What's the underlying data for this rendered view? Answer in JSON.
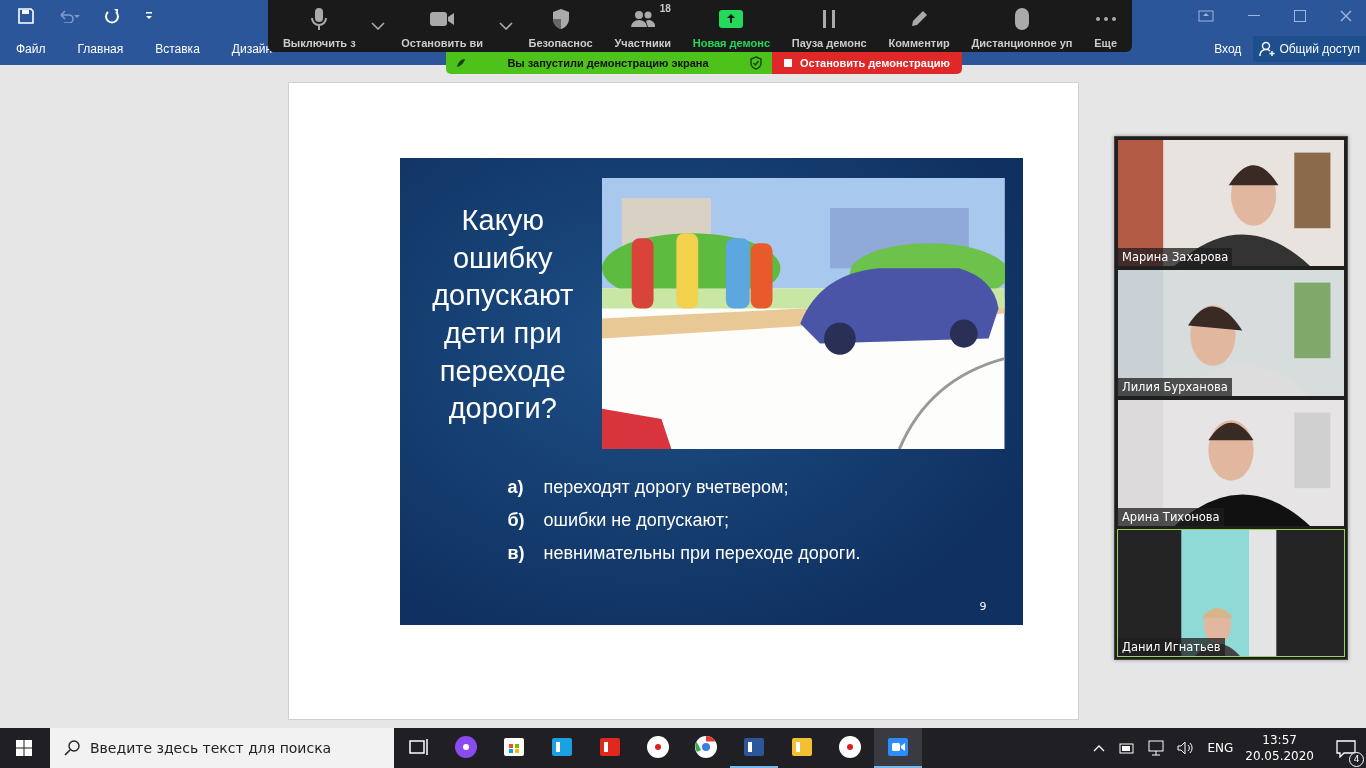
{
  "quick_access": [
    {
      "kind": "save",
      "disabled": false
    },
    {
      "kind": "undo",
      "disabled": true
    },
    {
      "kind": "redo",
      "disabled": false
    },
    {
      "kind": "customize",
      "disabled": false
    }
  ],
  "ribbon_tabs": [
    "Файл",
    "Главная",
    "Вставка",
    "Дизайн"
  ],
  "account": {
    "sign_in": "Вход",
    "share": "Общий доступ"
  },
  "meeting_toolbar": [
    {
      "kind": "mic",
      "label": "Выключить з",
      "dropdown": true,
      "highlighted": false
    },
    {
      "kind": "camera",
      "label": "Остановить ви",
      "dropdown": true,
      "highlighted": false
    },
    {
      "kind": "shield",
      "label": "Безопаснос",
      "dropdown": false,
      "highlighted": false
    },
    {
      "kind": "people",
      "label": "Участники",
      "count": "18",
      "dropdown": false,
      "highlighted": false
    },
    {
      "kind": "share",
      "label": "Новая демонс",
      "dropdown": false,
      "highlighted": true
    },
    {
      "kind": "pause",
      "label": "Пауза демонс",
      "dropdown": false,
      "highlighted": false
    },
    {
      "kind": "pen",
      "label": "Комментир",
      "dropdown": false,
      "highlighted": false
    },
    {
      "kind": "mouse",
      "label": "Дистанционное уп",
      "dropdown": false,
      "highlighted": false
    },
    {
      "kind": "more",
      "label": "Еще",
      "dropdown": false,
      "highlighted": false
    }
  ],
  "share_banner": {
    "message": "Вы запустили демонстрацию экрана",
    "stop": "Остановить демонстрацию"
  },
  "slide": {
    "question": "Какую ошибку допускают дети при переходе дороги?",
    "answers": [
      {
        "letter": "а)",
        "text": "переходят дорогу вчетвером;"
      },
      {
        "letter": "б)",
        "text": "ошибки не допускают;"
      },
      {
        "letter": "в)",
        "text": "невнимательны при переходе дороги."
      }
    ],
    "page_number": "9"
  },
  "videos": [
    {
      "name": "Марина Захарова",
      "active": false,
      "kind": "picture"
    },
    {
      "name": "Лилия Бурханова",
      "active": false,
      "kind": "picture"
    },
    {
      "name": "Арина Тихонова",
      "active": false,
      "kind": "picture"
    },
    {
      "name": "Данил Игнатьев",
      "active": true,
      "kind": "picture"
    }
  ],
  "taskbar": {
    "search_placeholder": "Введите здесь текст для поиска",
    "apps": [
      {
        "kind": "taskview",
        "running": false,
        "selected": false
      },
      {
        "kind": "alice",
        "running": false,
        "selected": false
      },
      {
        "kind": "store",
        "running": false,
        "selected": false
      },
      {
        "kind": "lapp",
        "running": false,
        "selected": false
      },
      {
        "kind": "redapp",
        "running": false,
        "selected": false
      },
      {
        "kind": "yandex",
        "running": false,
        "selected": false
      },
      {
        "kind": "chrome",
        "running": false,
        "selected": false
      },
      {
        "kind": "word",
        "running": true,
        "selected": false
      },
      {
        "kind": "explorer",
        "running": false,
        "selected": false
      },
      {
        "kind": "ybrowser",
        "running": false,
        "selected": false
      },
      {
        "kind": "zoom",
        "running": true,
        "selected": true
      }
    ],
    "language": "ENG",
    "time": "13:57",
    "date": "20.05.2020",
    "notifications": "4"
  }
}
